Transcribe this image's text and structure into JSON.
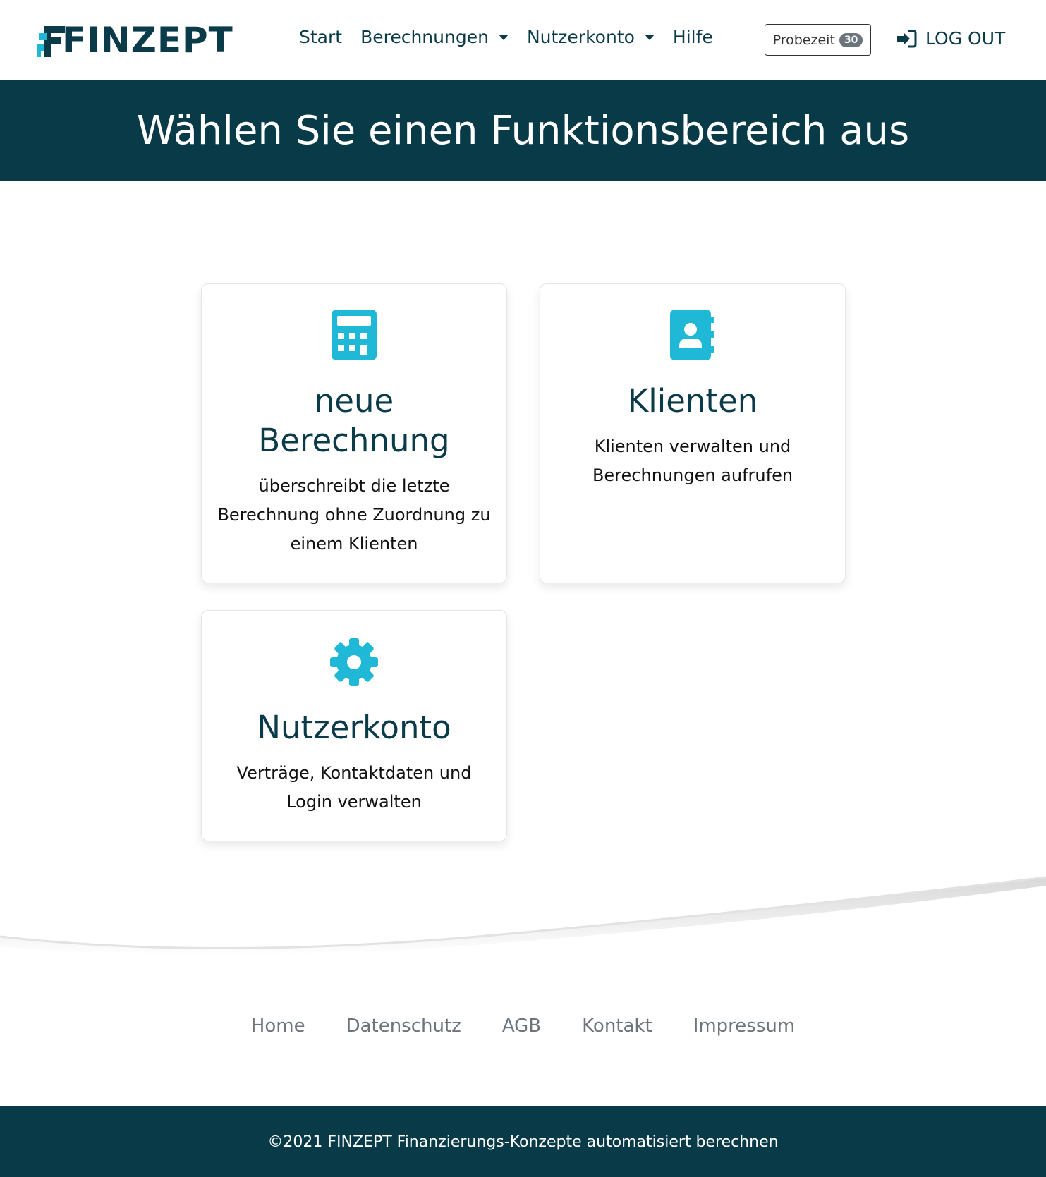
{
  "brand": {
    "logo_text": "FINZEPT",
    "accent_color": "#1fb8d6",
    "dark_color": "#083a48"
  },
  "nav": {
    "start": "Start",
    "calculations": "Berechnungen",
    "account": "Nutzerkonto",
    "help": "Hilfe",
    "trial_label": "Probezeit",
    "trial_days": "30",
    "logout": "LOG OUT"
  },
  "hero": {
    "title": "Wählen Sie einen Funktionsbereich aus"
  },
  "cards": [
    {
      "icon": "calculator-icon",
      "title_line1": "neue",
      "title_line2": "Berechnung",
      "text_line1": "überschreibt die letzte",
      "text_line2": "Berechnung ohne Zuordnung zu",
      "text_line3": "einem Klienten"
    },
    {
      "icon": "address-book-icon",
      "title": "Klienten",
      "text_line1": "Klienten verwalten und",
      "text_line2": "Berechnungen aufrufen"
    },
    {
      "icon": "gear-icon",
      "title": "Nutzerkonto",
      "text_line1": "Verträge, Kontaktdaten und",
      "text_line2": "Login verwalten"
    }
  ],
  "footer": {
    "links": [
      "Home",
      "Datenschutz",
      "AGB",
      "Kontakt",
      "Impressum"
    ],
    "copyright": "©2021 FINZEPT Finanzierungs-Konzepte automatisiert berechnen"
  }
}
